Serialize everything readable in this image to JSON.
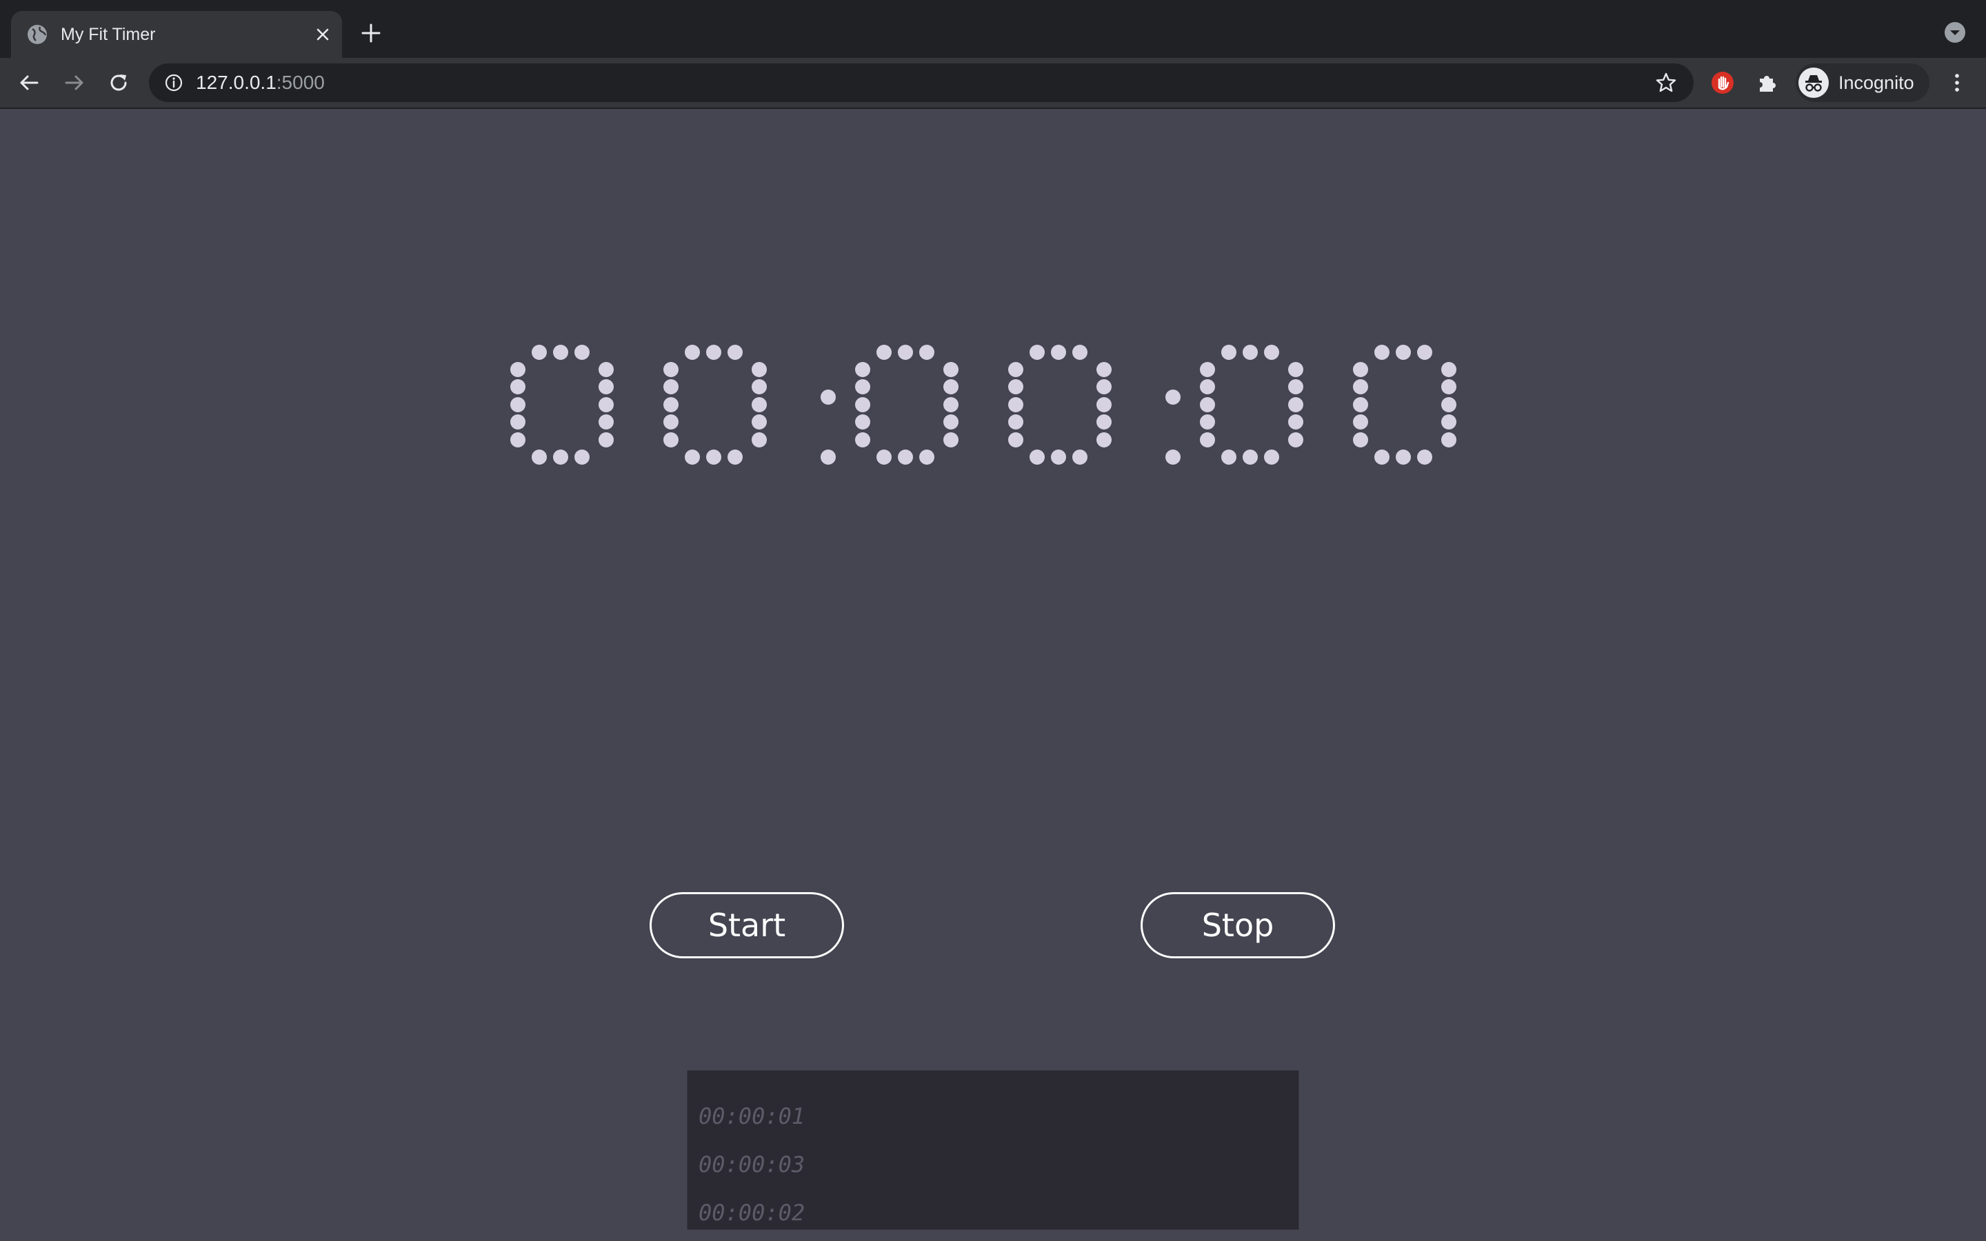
{
  "browser": {
    "tab_title": "My Fit Timer",
    "url_host": "127.0.0.1",
    "url_port": ":5000",
    "profile_label": "Incognito"
  },
  "timer": {
    "display": "00:00:00",
    "dot_color": "#d6d2e2"
  },
  "controls": {
    "start_label": "Start",
    "stop_label": "Stop"
  },
  "laps": [
    "00:00:01",
    "00:00:03",
    "00:00:02"
  ],
  "colors": {
    "page_background": "#454451",
    "lap_panel_background": "#2b2a33",
    "lap_text": "#5c5b68"
  }
}
